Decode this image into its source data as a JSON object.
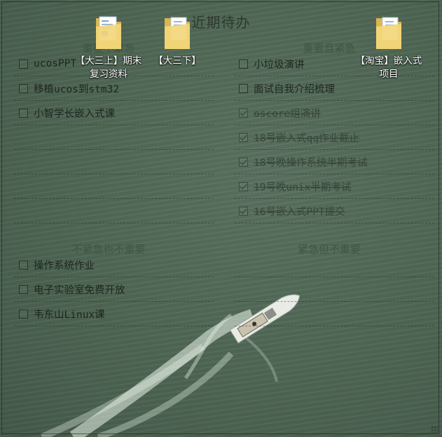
{
  "panel": {
    "title": "近期待办"
  },
  "quadrants": [
    {
      "heading": "重要不紧急",
      "items": [
        {
          "text": "ucosPPT",
          "done": false
        },
        {
          "text": "移植ucos到stm32",
          "done": false
        },
        {
          "text": "小智学长嵌入式课",
          "done": false
        }
      ]
    },
    {
      "heading": "重要且紧急",
      "items": [
        {
          "text": "小垃圾演讲",
          "done": false
        },
        {
          "text": "面试自我介绍梳理",
          "done": false
        },
        {
          "text": "oscore组演讲",
          "done": true
        },
        {
          "text": "18号嵌入式qq作业截止",
          "done": true
        },
        {
          "text": "18号晚操作系统半期考试",
          "done": true
        },
        {
          "text": "19号晚unix半期考试",
          "done": true
        },
        {
          "text": "16号嵌入式PPT提交",
          "done": true
        }
      ]
    },
    {
      "heading": "不紧急也不重要",
      "items": [
        {
          "text": "操作系统作业",
          "done": false
        },
        {
          "text": "电子实验室免费开放",
          "done": false
        },
        {
          "text": "韦东山Linux课",
          "done": false
        }
      ]
    },
    {
      "heading": "紧急但不重要",
      "items": []
    }
  ],
  "desktop_icons": [
    {
      "label": "【大三上】期末复习资料",
      "icon": "folder-icon"
    },
    {
      "label": "【大三下】",
      "icon": "folder-icon"
    },
    {
      "label": "【淘宝】嵌入式项目",
      "icon": "folder-icon"
    }
  ],
  "colors": {
    "water": "#4f6654",
    "text": "#1d2620",
    "heading": "#3f5644",
    "folder": "#f3d77a"
  }
}
